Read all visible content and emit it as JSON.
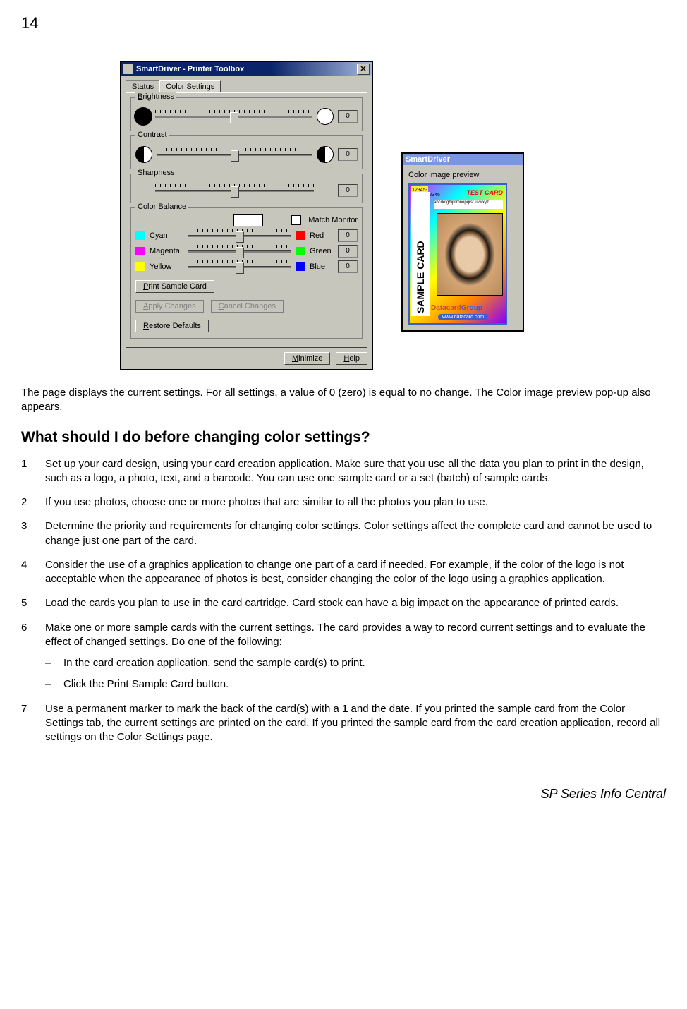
{
  "pageNumber": "14",
  "toolbox": {
    "title": "SmartDriver - Printer Toolbox",
    "tabs": {
      "status": "Status",
      "colorSettings": "Color Settings"
    },
    "groups": {
      "brightness": {
        "label": "Brightness",
        "value": "0"
      },
      "contrast": {
        "label": "Contrast",
        "value": "0"
      },
      "sharpness": {
        "label": "Sharpness",
        "value": "0"
      },
      "colorBalance": {
        "label": "Color Balance",
        "matchMonitor": "Match Monitor",
        "rows": [
          {
            "left": "Cyan",
            "right": "Red",
            "value": "0"
          },
          {
            "left": "Magenta",
            "right": "Green",
            "value": "0"
          },
          {
            "left": "Yellow",
            "right": "Blue",
            "value": "0"
          }
        ]
      }
    },
    "buttons": {
      "printSample": "Print Sample Card",
      "apply": "Apply Changes",
      "cancel": "Cancel Changes",
      "restore": "Restore Defaults",
      "minimize": "Minimize",
      "help": "Help"
    }
  },
  "preview": {
    "title": "SmartDriver",
    "label": "Color image preview",
    "card": {
      "side": "SAMPLE CARD",
      "num": "12345-\n12345/12345",
      "top": "TEST CARD",
      "strip": "abcdefghijklmnopqrst uvwxyz",
      "brand_d": "Datacard",
      "brand_g": "Group",
      "url": "www.datacard.com"
    }
  },
  "paragraph1": "The page displays the current settings. For all settings, a value of 0 (zero) is equal to no change. The Color image preview pop-up also appears.",
  "heading1": "What should I do before changing color settings?",
  "steps": [
    "Set up your card design, using your card creation application. Make sure that you use all the data you plan to print in the design, such as a logo, a photo, text, and a barcode. You can use one sample card or a set (batch) of sample cards.",
    "If you use photos, choose one or more photos that are similar to all the photos you plan to use.",
    "Determine the priority and requirements for changing color settings. Color settings affect the complete card and cannot be used to change just one part of the card.",
    "Consider the use of a graphics application to change one part of a card if needed. For example, if the color of the logo is not acceptable when the appearance of photos is best, consider changing the color of the logo using a graphics application.",
    "Load the cards you plan to use in the card cartridge. Card stock can have a big impact on the appearance of printed cards.",
    "Make one or more sample cards with the current settings. The card provides a way to record current settings and to evaluate the effect of changed settings. Do one of the following:",
    "Use a permanent marker to mark the back of the card(s) with a 1 and the date. If you printed the sample card from the Color Settings tab, the current settings are printed on the card. If you printed the sample card from the card creation application, record all settings on the Color Settings page."
  ],
  "substeps6": [
    "In the card creation application, send the sample card(s) to print.",
    "Click the Print Sample Card button."
  ],
  "step7_prefix": "Use a permanent marker to mark the back of the card(s) with a ",
  "step7_bold": "1",
  "step7_suffix": " and the date. If you printed the sample card from the Color Settings tab, the current settings are printed on the card. If you printed the sample card from the card creation application, record all settings on the Color Settings page.",
  "footer": "SP Series Info Central"
}
